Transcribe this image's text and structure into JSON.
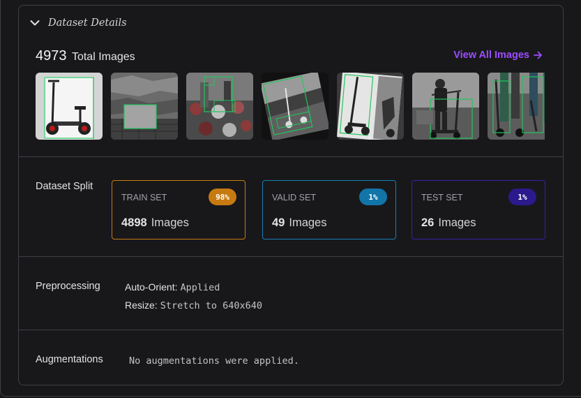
{
  "header": {
    "title": "Dataset Details"
  },
  "summary": {
    "total_count": "4973",
    "total_label": "Total Images",
    "view_all_label": "View All Images"
  },
  "thumbnails": [
    {
      "name": "thumb-scooter-white-bg"
    },
    {
      "name": "thumb-gray-wall"
    },
    {
      "name": "thumb-crowd-inverted"
    },
    {
      "name": "thumb-street-rotated"
    },
    {
      "name": "thumb-scooter-rotated"
    },
    {
      "name": "thumb-person-on-scooter"
    },
    {
      "name": "thumb-legs-scooter"
    }
  ],
  "split": {
    "label": "Dataset Split",
    "cards": [
      {
        "name": "TRAIN SET",
        "badge": "98%",
        "count": "4898",
        "unit": "Images",
        "color": "#c77a0f"
      },
      {
        "name": "VALID SET",
        "badge": "1%",
        "count": "49",
        "unit": "Images",
        "color": "#1175a8"
      },
      {
        "name": "TEST SET",
        "badge": "1%",
        "count": "26",
        "unit": "Images",
        "color": "#2a1a8c"
      }
    ]
  },
  "preprocessing": {
    "label": "Preprocessing",
    "steps": [
      {
        "key": "Auto-Orient:",
        "value": "Applied"
      },
      {
        "key": "Resize:",
        "value": "Stretch to 640x640"
      }
    ]
  },
  "augmentations": {
    "label": "Augmentations",
    "text": "No augmentations were applied."
  },
  "colors": {
    "accent": "#9b4dff",
    "border": "#3f3f46",
    "background": "#18181b",
    "bbox": "#22c55e"
  }
}
